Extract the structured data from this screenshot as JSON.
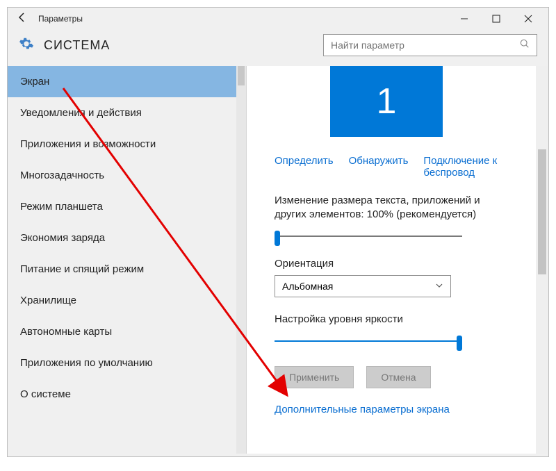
{
  "window": {
    "title": "Параметры"
  },
  "header": {
    "section": "СИСТЕМА",
    "search_placeholder": "Найти параметр"
  },
  "sidebar": {
    "items": [
      {
        "label": "Экран",
        "active": true
      },
      {
        "label": "Уведомления и действия",
        "active": false
      },
      {
        "label": "Приложения и возможности",
        "active": false
      },
      {
        "label": "Многозадачность",
        "active": false
      },
      {
        "label": "Режим планшета",
        "active": false
      },
      {
        "label": "Экономия заряда",
        "active": false
      },
      {
        "label": "Питание и спящий режим",
        "active": false
      },
      {
        "label": "Хранилище",
        "active": false
      },
      {
        "label": "Автономные карты",
        "active": false
      },
      {
        "label": "Приложения по умолчанию",
        "active": false
      },
      {
        "label": "О системе",
        "active": false
      }
    ]
  },
  "display": {
    "monitor_id": "1",
    "detect_links": {
      "identify": "Определить",
      "detect": "Обнаружить",
      "wireless": "Подключение к беспровод"
    },
    "scale_label": "Изменение размера текста, приложений и других элементов: 100% (рекомендуется)",
    "orientation_label": "Ориентация",
    "orientation_value": "Альбомная",
    "brightness_label": "Настройка уровня яркости",
    "buttons": {
      "apply": "Применить",
      "cancel": "Отмена"
    },
    "advanced_link": "Дополнительные параметры экрана",
    "colors": {
      "accent": "#0078d7",
      "link": "#0a6ed1"
    }
  }
}
